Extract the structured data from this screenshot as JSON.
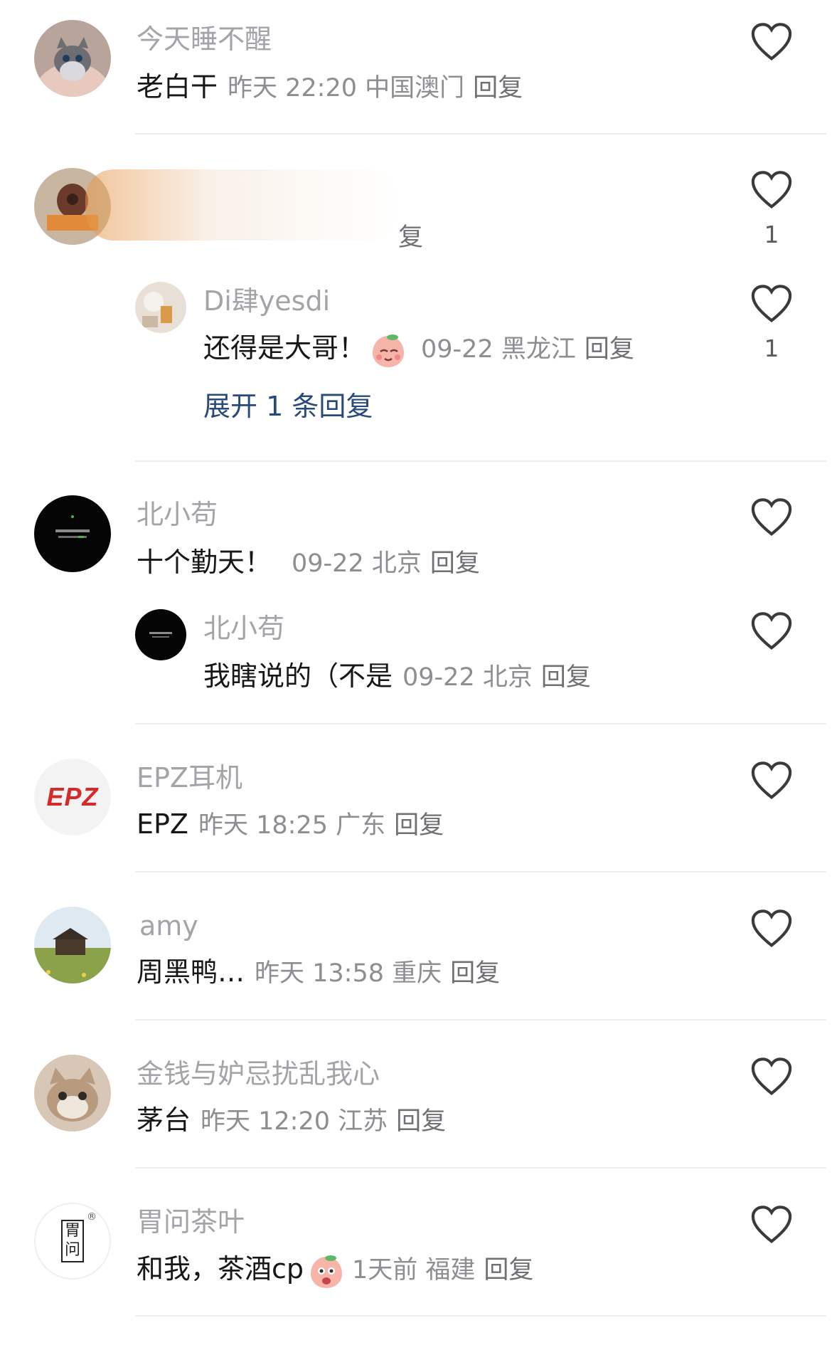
{
  "comments": [
    {
      "user": "今天睡不醒",
      "content": "老白干",
      "meta": "昨天 22:20 中国澳门",
      "reply": "回复",
      "likes": ""
    },
    {
      "user": "",
      "content": "",
      "meta": "",
      "reply": "复",
      "likes": "1"
    },
    {
      "user": "Di肆yesdi",
      "content": "还得是大哥！",
      "meta": "09-22 黑龙江",
      "reply": "回复",
      "likes": "1"
    },
    {
      "user": "北小苟",
      "content": "十个勤天！",
      "meta": "09-22 北京",
      "reply": "回复",
      "likes": ""
    },
    {
      "user": "北小苟",
      "content": "我瞎说的（不是",
      "meta": "09-22 北京",
      "reply": "回复",
      "likes": ""
    },
    {
      "user": "EPZ耳机",
      "content": "EPZ",
      "meta": "昨天 18:25 广东",
      "reply": "回复",
      "likes": ""
    },
    {
      "user": "amy",
      "content": "周黑鸭…",
      "meta": "昨天 13:58 重庆",
      "reply": "回复",
      "likes": ""
    },
    {
      "user": "金钱与妒忌扰乱我心",
      "content": "茅台",
      "meta": "昨天 12:20 江苏",
      "reply": "回复",
      "likes": ""
    },
    {
      "user": "胃问茶叶",
      "content": "和我，茶酒cp",
      "meta": "1天前 福建",
      "reply": "回复",
      "likes": ""
    }
  ],
  "expand_replies": "展开 1 条回复",
  "epz_logo": "EPZ",
  "tea_logo_top": "胃",
  "tea_logo_bottom": "问",
  "tea_logo_mark": "®",
  "icons": {
    "like": "heart-outline-icon",
    "emoji": "peach-emoji-icon"
  },
  "colors": {
    "name": "#a3a3a8",
    "content": "#17171a",
    "meta": "#8d8d92",
    "link": "#274a7a",
    "divider": "#ededf0"
  }
}
